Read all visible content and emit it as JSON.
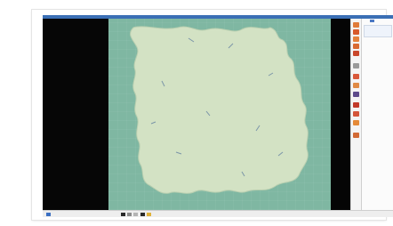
{
  "app": {
    "title": ""
  },
  "left_panel": {
    "header": ""
  },
  "canvas": {
    "background": "#7fb7a2",
    "shape_fill": "#d3e2c4",
    "shape_stroke": "#b9cfb0"
  },
  "toolbar": {
    "tools": [
      {
        "name": "open-icon",
        "color": "#e07b39"
      },
      {
        "name": "save-icon",
        "color": "#d85a2a"
      },
      {
        "name": "select-icon",
        "color": "#e4823d"
      },
      {
        "name": "move-icon",
        "color": "#d96b33"
      },
      {
        "name": "rotate-icon",
        "color": "#c9472b"
      },
      {
        "name": "cut-icon",
        "color": "#9a9a9a"
      },
      {
        "name": "pen-icon",
        "color": "#d9583a"
      },
      {
        "name": "line-icon",
        "color": "#e08a45"
      },
      {
        "name": "hat-icon",
        "color": "#5d4a8a"
      },
      {
        "name": "layer-icon",
        "color": "#c23a2a"
      },
      {
        "name": "link-icon",
        "color": "#d4553a"
      },
      {
        "name": "color-icon",
        "color": "#e58a38"
      },
      {
        "name": "export-icon",
        "color": "#d26a35"
      }
    ]
  },
  "props": {
    "rows": [
      "",
      "",
      "",
      ""
    ]
  },
  "statusbar": {
    "message": "",
    "info": ""
  }
}
